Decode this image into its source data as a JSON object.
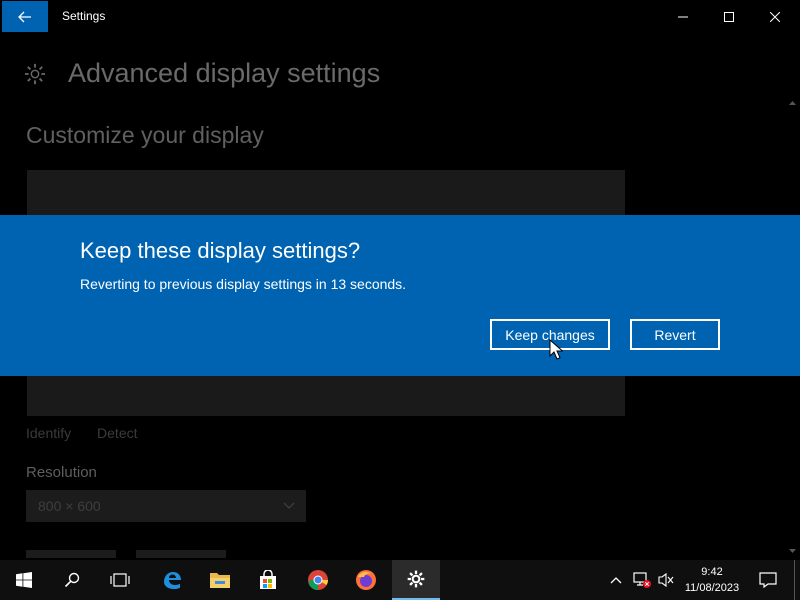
{
  "window": {
    "title": "Settings"
  },
  "page": {
    "title": "Advanced display settings",
    "section_title": "Customize your display",
    "identify_label": "Identify",
    "detect_label": "Detect",
    "resolution_label": "Resolution",
    "resolution_value": "800 × 600"
  },
  "dialog": {
    "title": "Keep these display settings?",
    "message": "Reverting to previous display settings in 13 seconds.",
    "keep_label": "Keep changes",
    "revert_label": "Revert"
  },
  "taskbar": {
    "apps": [
      "start-icon",
      "search-icon",
      "task-view-icon",
      "edge-icon",
      "file-explorer-icon",
      "store-icon",
      "chrome-icon",
      "firefox-icon",
      "settings-icon"
    ],
    "clock_time": "9:42",
    "clock_date": "11/08/2023"
  },
  "colors": {
    "accent": "#0063b1",
    "background": "#000000",
    "taskbar": "#0f0f0f"
  }
}
